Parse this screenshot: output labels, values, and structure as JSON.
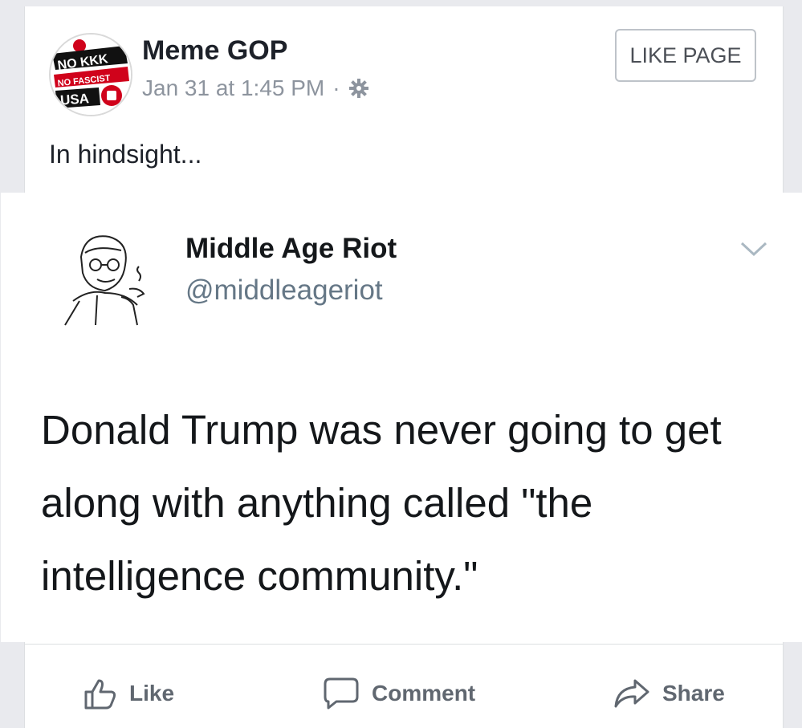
{
  "post": {
    "page_name": "Meme GOP",
    "timestamp": "Jan 31 at 1:45 PM",
    "dot": "·",
    "like_page_label": "LIKE PAGE",
    "text": "In hindsight...",
    "avatar_icon": "no-kkk-logo",
    "privacy_icon": "gear-icon"
  },
  "tweet": {
    "name": "Middle Age Riot",
    "handle": "@middleageriot",
    "body": "Donald Trump was never going to get along with anything called \"the intelligence community.\"",
    "menu_icon": "chevron-down-icon"
  },
  "actions": [
    {
      "label": "Like",
      "icon": "thumbs-up-icon"
    },
    {
      "label": "Comment",
      "icon": "comment-icon"
    },
    {
      "label": "Share",
      "icon": "share-icon"
    }
  ],
  "logo": {
    "line1": "NO KKK",
    "line2": "NO FASCIST",
    "line3": "USA"
  },
  "colors": {
    "page_name": "#1d2129",
    "meta": "#8d949e",
    "handle": "#657786",
    "logo_red": "#d0021b"
  }
}
